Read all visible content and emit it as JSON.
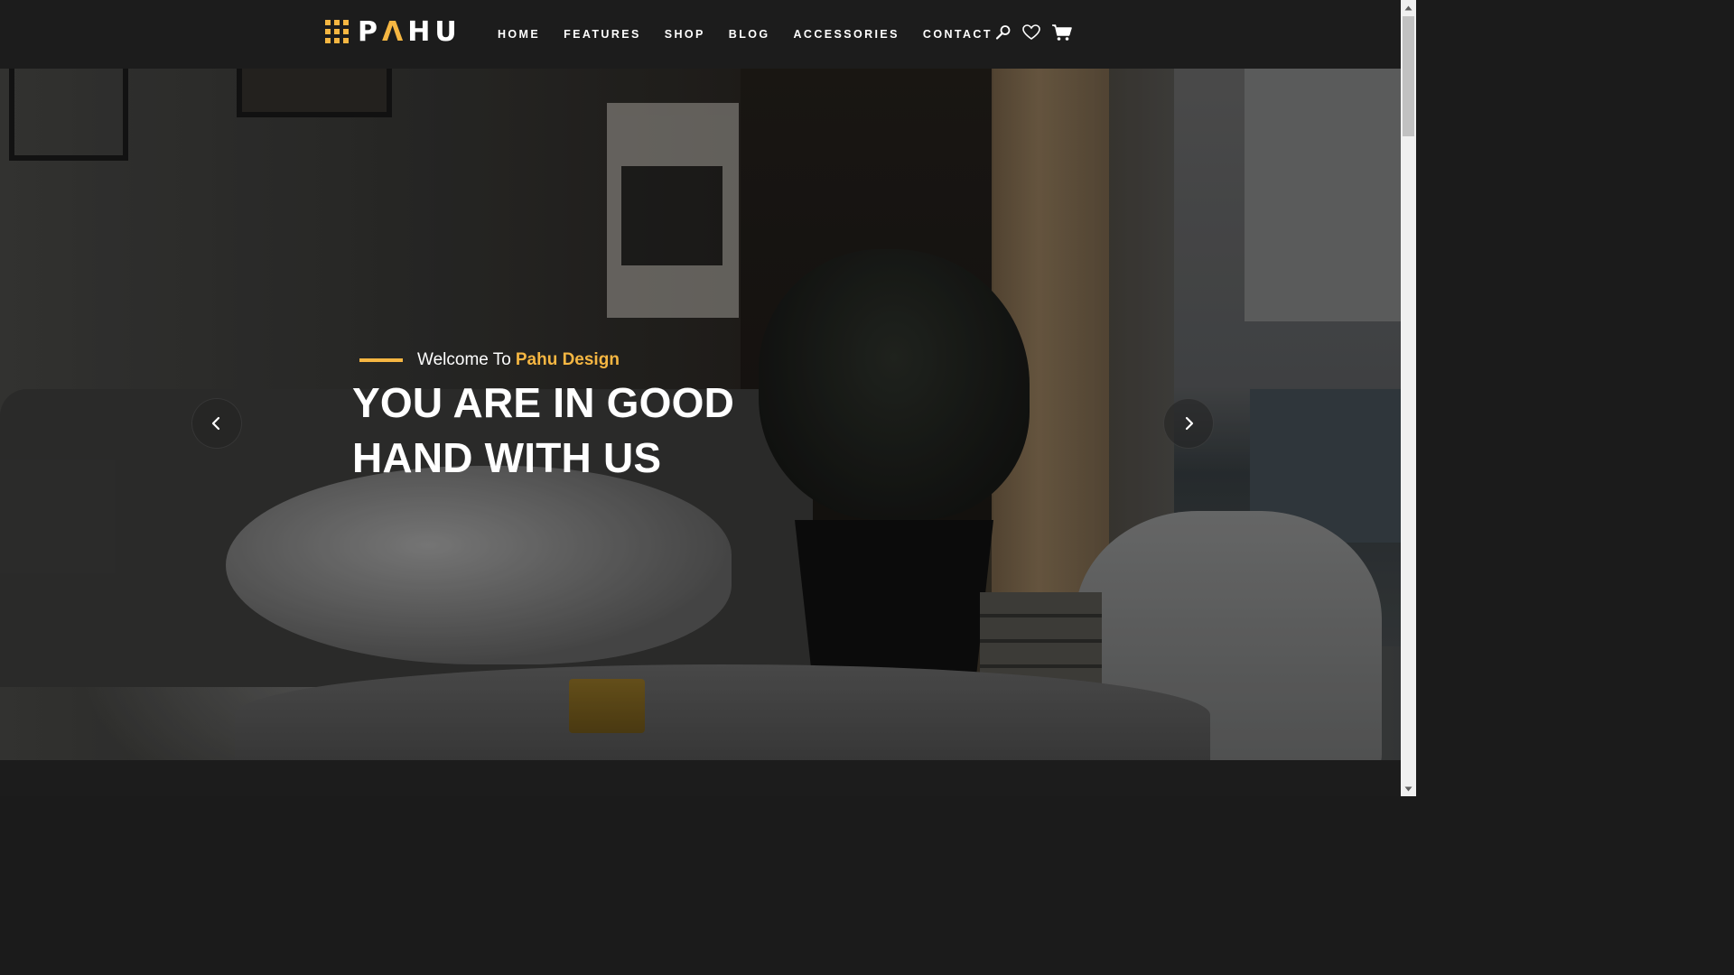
{
  "header": {
    "logo": {
      "part1": "P",
      "accent": "Λ",
      "part2": "HU"
    },
    "nav": [
      "HOME",
      "FEATURES",
      "SHOP",
      "BLOG",
      "ACCESSORIES",
      "CONTACT"
    ],
    "icons": [
      "search-icon",
      "heart-icon",
      "cart-icon"
    ]
  },
  "hero": {
    "welcome_text": "Welcome To",
    "welcome_brand": "Pahu Design",
    "headline_line1": "YOU ARE IN GOOD",
    "headline_line2": "HAND WITH US",
    "prev_icon": "chevron-left-icon",
    "next_icon": "chevron-right-icon"
  },
  "colors": {
    "accent": "#f5b642",
    "header_bg": "#1c1c1c",
    "text": "#ffffff"
  }
}
